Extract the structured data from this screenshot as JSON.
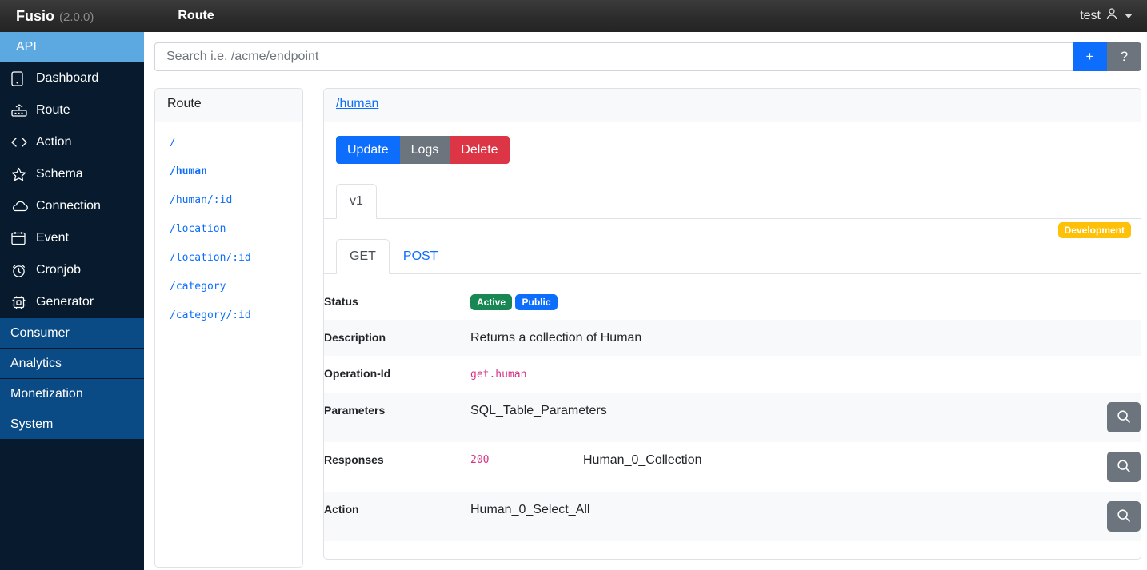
{
  "navbar": {
    "brand": "Fusio",
    "version": "(2.0.0)",
    "page_title": "Route",
    "user_label": "test"
  },
  "sidebar": {
    "api_section": "API",
    "items": [
      {
        "label": "Dashboard",
        "icon": "dashboard-icon"
      },
      {
        "label": "Route",
        "icon": "route-icon"
      },
      {
        "label": "Action",
        "icon": "code-icon"
      },
      {
        "label": "Schema",
        "icon": "star-icon"
      },
      {
        "label": "Connection",
        "icon": "cloud-icon"
      },
      {
        "label": "Event",
        "icon": "calendar-icon"
      },
      {
        "label": "Cronjob",
        "icon": "alarm-clock-icon"
      },
      {
        "label": "Generator",
        "icon": "chip-icon"
      }
    ],
    "sections": [
      {
        "label": "Consumer"
      },
      {
        "label": "Analytics"
      },
      {
        "label": "Monetization"
      },
      {
        "label": "System"
      }
    ]
  },
  "search": {
    "placeholder": "Search i.e. /acme/endpoint",
    "value": "",
    "add_label": "+",
    "help_label": "?"
  },
  "route_list": {
    "title": "Route",
    "selected": "/human",
    "items": [
      {
        "path": "/"
      },
      {
        "path": "/human"
      },
      {
        "path": "/human/:id"
      },
      {
        "path": "/location"
      },
      {
        "path": "/location/:id"
      },
      {
        "path": "/category"
      },
      {
        "path": "/category/:id"
      }
    ]
  },
  "detail": {
    "title": "/human",
    "buttons": {
      "update": "Update",
      "logs": "Logs",
      "delete": "Delete"
    },
    "version_tab": "v1",
    "status_badge": "Development",
    "method_tabs": {
      "get": "GET",
      "post": "POST"
    },
    "rows": {
      "status": {
        "label": "Status",
        "badge_active": "Active",
        "badge_public": "Public"
      },
      "description": {
        "label": "Description",
        "value": "Returns a collection of Human"
      },
      "operation_id": {
        "label": "Operation-Id",
        "value": "get.human"
      },
      "parameters": {
        "label": "Parameters",
        "value": "SQL_Table_Parameters"
      },
      "responses": {
        "label": "Responses",
        "code": "200",
        "value": "Human_0_Collection"
      },
      "action": {
        "label": "Action",
        "value": "Human_0_Select_All"
      }
    }
  },
  "colors": {
    "primary": "#0d6efd",
    "success": "#198754",
    "danger": "#dc3545",
    "warning": "#ffc107",
    "secondary": "#6c757d",
    "sidebar_bg": "#071a2e",
    "sidebar_active": "#5ca8e0",
    "sidebar_section": "#0a4a85",
    "code_text": "#d63384"
  }
}
